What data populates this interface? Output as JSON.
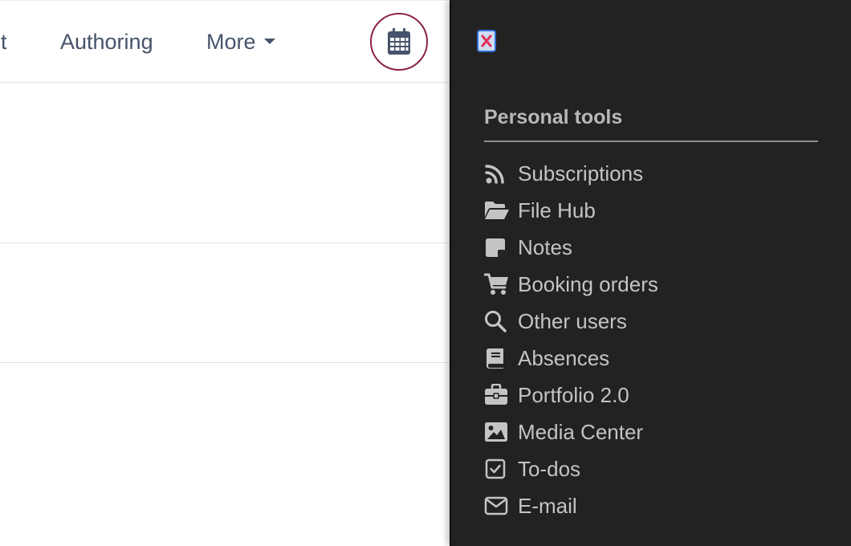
{
  "topnav": {
    "partial_label": "nt",
    "authoring_label": "Authoring",
    "more_label": "More",
    "calendar_icon": "calendar-icon"
  },
  "drawer": {
    "close_icon": "close-icon",
    "section_title": "Personal tools",
    "items": [
      {
        "label": "Subscriptions",
        "icon": "rss-icon"
      },
      {
        "label": "File Hub",
        "icon": "folder-open-icon"
      },
      {
        "label": "Notes",
        "icon": "sticky-note-icon"
      },
      {
        "label": "Booking orders",
        "icon": "shopping-cart-icon"
      },
      {
        "label": "Other users",
        "icon": "search-icon"
      },
      {
        "label": "Absences",
        "icon": "book-icon"
      },
      {
        "label": "Portfolio 2.0",
        "icon": "briefcase-icon"
      },
      {
        "label": "Media Center",
        "icon": "image-icon"
      },
      {
        "label": "To-dos",
        "icon": "checkbox-icon"
      },
      {
        "label": "E-mail",
        "icon": "envelope-icon"
      }
    ]
  },
  "colors": {
    "nav_text": "#46536a",
    "calendar_ring": "#8a2440",
    "drawer_bg": "#222222",
    "drawer_text": "#c4c4c4",
    "drawer_title": "#b8b8b8"
  }
}
